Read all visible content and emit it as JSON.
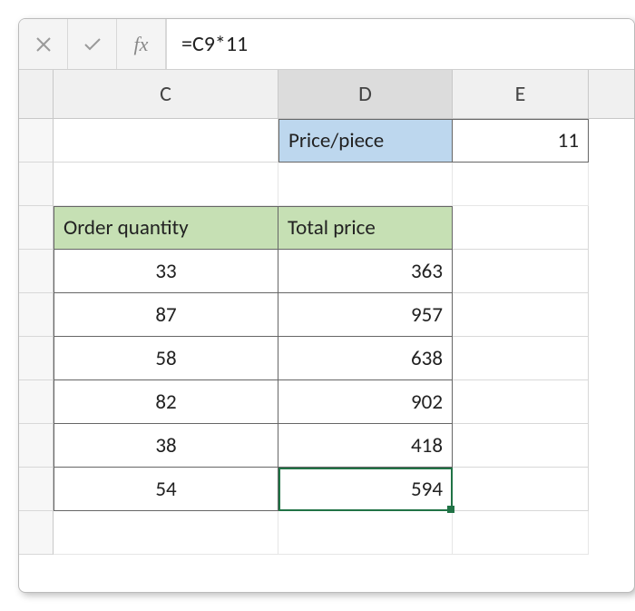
{
  "formula_bar": {
    "cancel_icon": "close-icon",
    "confirm_icon": "check-icon",
    "fx_label": "fx",
    "formula": "=C9*11"
  },
  "columns": {
    "c": "C",
    "d": "D",
    "e": "E"
  },
  "sheet": {
    "price_label": "Price/piece",
    "price_value": "11",
    "table": {
      "header_qty": "Order quantity",
      "header_total": "Total price",
      "rows": [
        {
          "qty": "33",
          "total": "363"
        },
        {
          "qty": "87",
          "total": "957"
        },
        {
          "qty": "58",
          "total": "638"
        },
        {
          "qty": "82",
          "total": "902"
        },
        {
          "qty": "38",
          "total": "418"
        },
        {
          "qty": "54",
          "total": "594"
        }
      ]
    }
  },
  "colors": {
    "header_blue": "#bdd7ee",
    "header_green": "#c6e0b4",
    "excel_green": "#217346"
  }
}
